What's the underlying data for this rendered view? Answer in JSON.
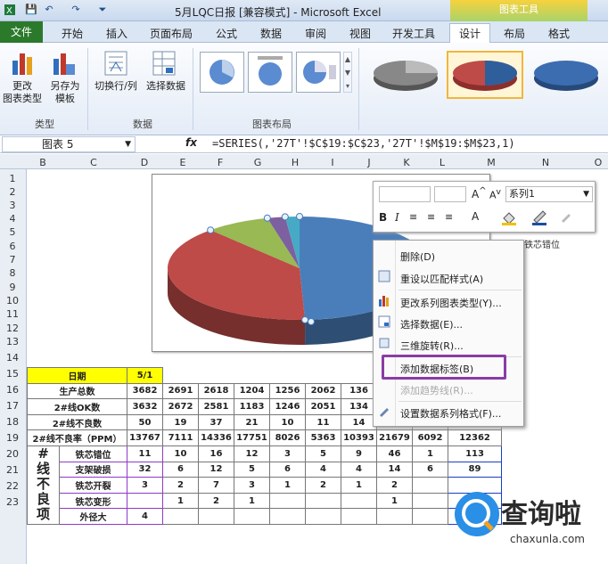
{
  "window": {
    "title": "5月LQC日报  [兼容模式] - Microsoft Excel",
    "contextual_band": "图表工具"
  },
  "tabs": [
    "文件",
    "开始",
    "插入",
    "页面布局",
    "公式",
    "数据",
    "审阅",
    "视图",
    "开发工具",
    "设计",
    "布局",
    "格式"
  ],
  "ribbon": {
    "type_group": {
      "btn1_line1": "更改",
      "btn1_line2": "图表类型",
      "btn2_line1": "另存为",
      "btn2_line2": "模板",
      "label": "类型"
    },
    "data_group": {
      "btn1": "切换行/列",
      "btn2": "选择数据",
      "label": "数据"
    },
    "layout_group": {
      "label": "图表布局"
    }
  },
  "formula_bar": {
    "name_box": "图表 5",
    "fx": "fx",
    "formula": "=SERIES(,'27T'!$C$19:$C$23,'27T'!$M$19:$M$23,1)"
  },
  "columns": [
    "B",
    "C",
    "D",
    "E",
    "F",
    "G",
    "H",
    "I",
    "J",
    "K",
    "L",
    "M",
    "N",
    "O"
  ],
  "rows": [
    "1",
    "2",
    "3",
    "4",
    "5",
    "6",
    "7",
    "8",
    "9",
    "10",
    "11",
    "12",
    "13",
    "14",
    "15",
    "16",
    "17",
    "18",
    "19",
    "20",
    "21",
    "22",
    "23"
  ],
  "mini_toolbar": {
    "series_select": "系列1"
  },
  "context_menu": {
    "items": [
      "删除(D)",
      "重设以匹配样式(A)",
      "更改系列图表类型(Y)...",
      "选择数据(E)...",
      "三维旋转(R)...",
      "添加数据标签(B)",
      "添加趋势线(R)...",
      "设置数据系列格式(F)..."
    ]
  },
  "table": {
    "header_label": "日期",
    "header_value": "5/1",
    "rows": [
      {
        "label": "生产总数",
        "values": [
          "3682",
          "2691",
          "2618",
          "1204",
          "1256",
          "2062",
          "136"
        ],
        "m": ""
      },
      {
        "label": "2#线OK数",
        "values": [
          "3632",
          "2672",
          "2581",
          "1183",
          "1246",
          "2051",
          "134"
        ],
        "m": ""
      },
      {
        "label": "2#线不良数",
        "values": [
          "50",
          "19",
          "37",
          "21",
          "10",
          "11",
          "14",
          "63",
          "7"
        ],
        "m": "232"
      },
      {
        "label": "2#线不良率（PPM）",
        "values": [
          "13767",
          "7111",
          "14336",
          "17751",
          "8026",
          "5363",
          "10393",
          "21679",
          "6092"
        ],
        "m": "12362"
      }
    ],
    "defect_group": [
      "#",
      "线",
      "不",
      "良",
      "项"
    ],
    "defects": [
      {
        "label": "铁芯错位",
        "values": [
          "11",
          "10",
          "16",
          "12",
          "3",
          "5",
          "9",
          "46",
          "1"
        ],
        "m": "113"
      },
      {
        "label": "支架破损",
        "values": [
          "32",
          "6",
          "12",
          "5",
          "6",
          "4",
          "4",
          "14",
          "6"
        ],
        "m": "89"
      },
      {
        "label": "铁芯开裂",
        "values": [
          "3",
          "2",
          "7",
          "3",
          "1",
          "2",
          "1",
          "2",
          ""
        ],
        "m": ""
      },
      {
        "label": "铁芯变形",
        "values": [
          "",
          "1",
          "2",
          "1",
          "",
          "",
          "",
          "1",
          ""
        ],
        "m": ""
      },
      {
        "label": "外径大",
        "values": [
          "4",
          "",
          "",
          "",
          "",
          "",
          "",
          "",
          ""
        ],
        "m": ""
      }
    ]
  },
  "chart_data": {
    "type": "pie",
    "slices": [
      {
        "label": "铁芯错位",
        "value": 113,
        "color": "#4a7ebb"
      },
      {
        "label": "支架破损",
        "value": 89,
        "color": "#be4b48"
      },
      {
        "label": "铁芯开裂",
        "value": 18,
        "color": "#98b954"
      },
      {
        "label": "铁芯变形",
        "value": 5,
        "color": "#7d60a0"
      },
      {
        "label": "外径大",
        "value": 4,
        "color": "#46aac5"
      }
    ],
    "legend_partial": "铁芯错位"
  },
  "watermark": {
    "text": "查询啦",
    "sub": "chaxunla.com"
  }
}
